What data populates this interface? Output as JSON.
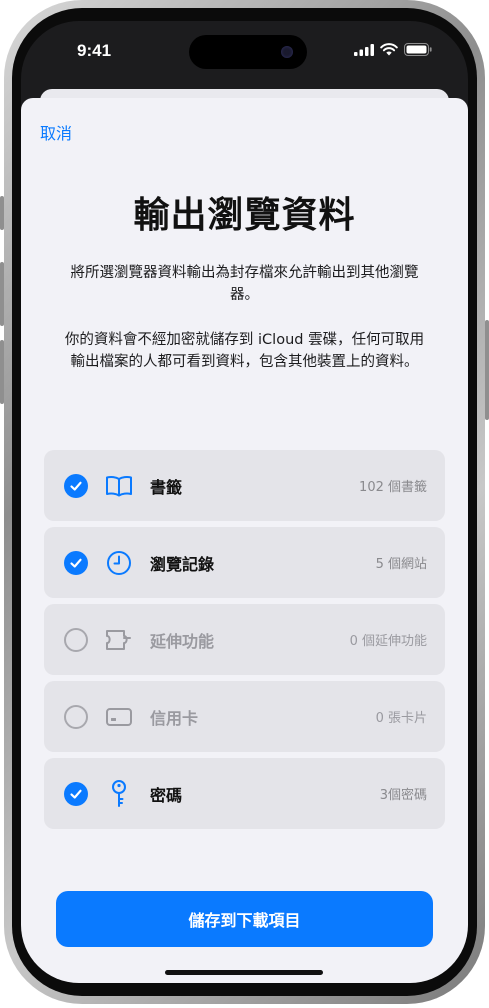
{
  "status_bar": {
    "time": "9:41"
  },
  "sheet": {
    "cancel_label": "取消",
    "title": "輸出瀏覽資料",
    "description_1": "將所選瀏覽器資料輸出為封存檔來允許輸出到其他瀏覽器。",
    "description_2": "你的資料會不經加密就儲存到 iCloud 雲碟，任何可取用輸出檔案的人都可看到資料，包含其他裝置上的資料。",
    "options": [
      {
        "label": "書籤",
        "count": "102 個書籤",
        "checked": true,
        "icon": "book-icon"
      },
      {
        "label": "瀏覽記錄",
        "count": "5 個網站",
        "checked": true,
        "icon": "clock-icon"
      },
      {
        "label": "延伸功能",
        "count": "0 個延伸功能",
        "checked": false,
        "icon": "puzzle-icon"
      },
      {
        "label": "信用卡",
        "count": "0 張卡片",
        "checked": false,
        "icon": "credit-card-icon"
      },
      {
        "label": "密碼",
        "count": "3個密碼",
        "checked": true,
        "icon": "key-icon"
      }
    ],
    "save_button_label": "儲存到下載項目"
  },
  "colors": {
    "accent": "#0a7aff",
    "sheet_bg": "#f2f2f7",
    "row_bg": "#e4e4e9"
  }
}
